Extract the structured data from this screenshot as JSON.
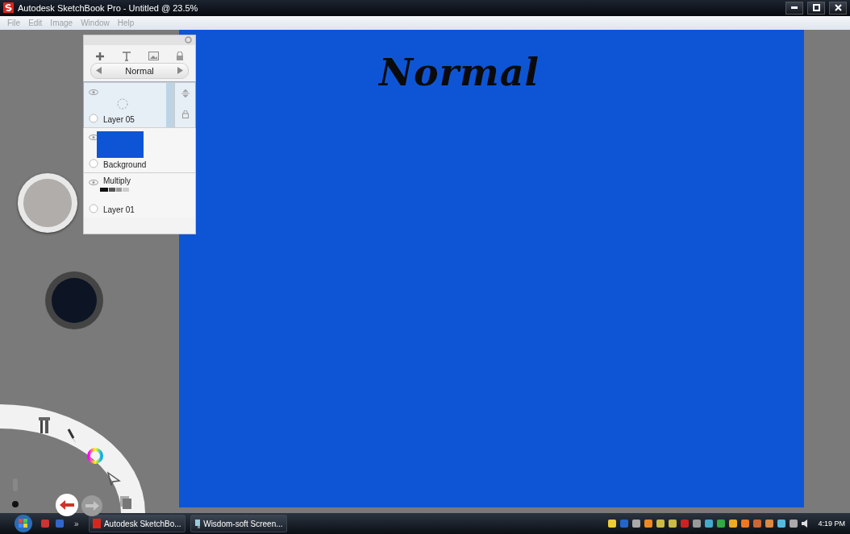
{
  "window": {
    "title": "Autodesk SketchBook Pro - Untitled @ 23.5%"
  },
  "menu": [
    "File",
    "Edit",
    "Image",
    "Window",
    "Help"
  ],
  "layer_panel": {
    "blend_mode": "Normal",
    "layers": [
      {
        "name": "Layer 05",
        "selected": true,
        "kind": "empty"
      },
      {
        "name": "Background",
        "selected": false,
        "kind": "fill"
      },
      {
        "name": "Layer 01",
        "selected": false,
        "kind": "blend",
        "blend_mode": "Multiply"
      }
    ]
  },
  "canvas": {
    "text": "Normal"
  },
  "taskbar": {
    "overflow": "»",
    "tasks": [
      {
        "label": "Autodesk SketchBo...",
        "kind": "sketchbook"
      },
      {
        "label": "Wisdom-soft Screen...",
        "kind": "monitor"
      }
    ],
    "clock": "4:19 PM"
  }
}
